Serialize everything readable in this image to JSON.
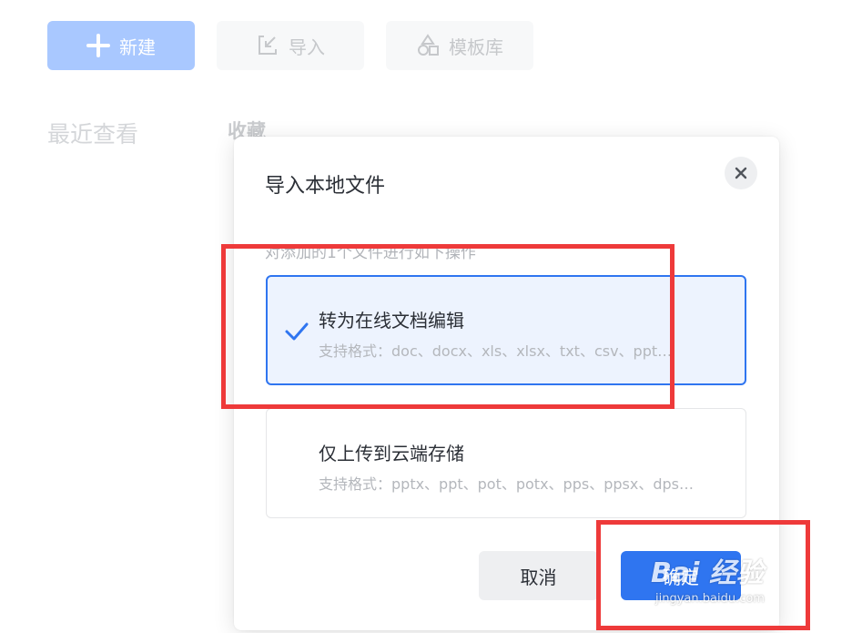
{
  "toolbar": {
    "new_label": "新建",
    "import_label": "导入",
    "template_label": "模板库"
  },
  "sections": {
    "recent_label": "最近查看",
    "favorites_label": "收藏"
  },
  "dialog": {
    "title": "导入本地文件",
    "subtitle": "对添加的1个文件进行如下操作",
    "options": [
      {
        "title": "转为在线文档编辑",
        "formats": "支持格式：doc、docx、xls、xlsx、txt、csv、ppt…",
        "selected": true
      },
      {
        "title": "仅上传到云端存储",
        "formats": "支持格式：pptx、ppt、pot、potx、pps、ppsx、dps…",
        "selected": false
      }
    ],
    "cancel_label": "取消",
    "confirm_label": "确定"
  },
  "watermark": {
    "text": "Bai 经验",
    "subtext": "jingyan.baidu.com"
  },
  "colors": {
    "accent": "#2f75f0",
    "accent_light": "#edf3fe",
    "new_button": "#a9c8ff",
    "annotation_red": "#ee3a3a"
  }
}
